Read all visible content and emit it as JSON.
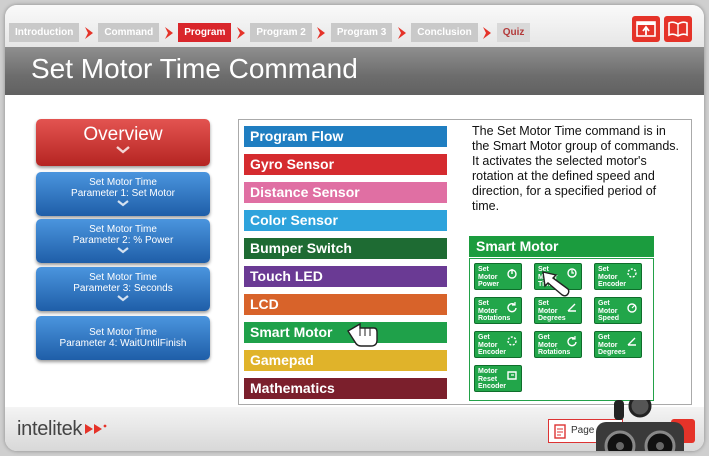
{
  "nav": {
    "crumbs": [
      {
        "label": "Introduction",
        "active": false
      },
      {
        "label": "Command",
        "active": false
      },
      {
        "label": "Program",
        "active": true
      },
      {
        "label": "Program 2",
        "active": false
      },
      {
        "label": "Program 3",
        "active": false
      },
      {
        "label": "Conclusion",
        "active": false
      },
      {
        "label": "Quiz",
        "active": false
      }
    ],
    "icons": [
      "return-icon",
      "book-icon"
    ]
  },
  "title": "Set Motor Time Command",
  "sidebar": {
    "overview": "Overview",
    "items": [
      {
        "line1": "Set Motor Time",
        "line2": "Parameter 1: Set Motor"
      },
      {
        "line1": "Set Motor Time",
        "line2": "Parameter 2: % Power"
      },
      {
        "line1": "Set Motor Time",
        "line2": "Parameter 3: Seconds"
      },
      {
        "line1": "Set Motor Time",
        "line2": "Parameter 4: WaitUntilFinish"
      }
    ]
  },
  "categories": [
    {
      "label": "Program Flow",
      "color": "#1f7ec1"
    },
    {
      "label": "Gyro Sensor",
      "color": "#d52b2f"
    },
    {
      "label": "Distance Sensor",
      "color": "#e06fa3"
    },
    {
      "label": "Color Sensor",
      "color": "#2ea3dc"
    },
    {
      "label": "Bumper Switch",
      "color": "#1e6b33"
    },
    {
      "label": "Touch LED",
      "color": "#6a3a94"
    },
    {
      "label": "LCD",
      "color": "#d8632a"
    },
    {
      "label": "Smart Motor",
      "color": "#1fa14a"
    },
    {
      "label": "Gamepad",
      "color": "#e0b32a"
    },
    {
      "label": "Mathematics",
      "color": "#7b1f2c"
    }
  ],
  "description": "The Set Motor Time command is in the Smart Motor group of commands. It activates the selected motor's rotation at the defined speed and direction, for a specified period of time.",
  "smart_motor": {
    "title": "Smart Motor",
    "tiles": [
      {
        "l1": "Set",
        "l2": "Motor",
        "l3": "Power",
        "icon": "power-icon"
      },
      {
        "l1": "Set",
        "l2": "Motor",
        "l3": "Time",
        "icon": "clock-icon"
      },
      {
        "l1": "Set",
        "l2": "Motor",
        "l3": "Encoder",
        "icon": "encoder-icon"
      },
      {
        "l1": "Set",
        "l2": "Motor",
        "l3": "Rotations",
        "icon": "rotation-icon"
      },
      {
        "l1": "Set",
        "l2": "Motor",
        "l3": "Degrees",
        "icon": "degrees-icon"
      },
      {
        "l1": "Get",
        "l2": "Motor",
        "l3": "Speed",
        "icon": "speed-icon"
      },
      {
        "l1": "Get",
        "l2": "Motor",
        "l3": "Encoder",
        "icon": "encoder-icon"
      },
      {
        "l1": "Get",
        "l2": "Motor",
        "l3": "Rotations",
        "icon": "rotation-icon"
      },
      {
        "l1": "Get",
        "l2": "Motor",
        "l3": "Degrees",
        "icon": "degrees-icon"
      },
      {
        "l1": "Motor",
        "l2": "Reset",
        "l3": "Encoder",
        "icon": "reset-encoder-icon"
      }
    ]
  },
  "footer": {
    "logo": "intelitek",
    "page_label": "Page"
  }
}
